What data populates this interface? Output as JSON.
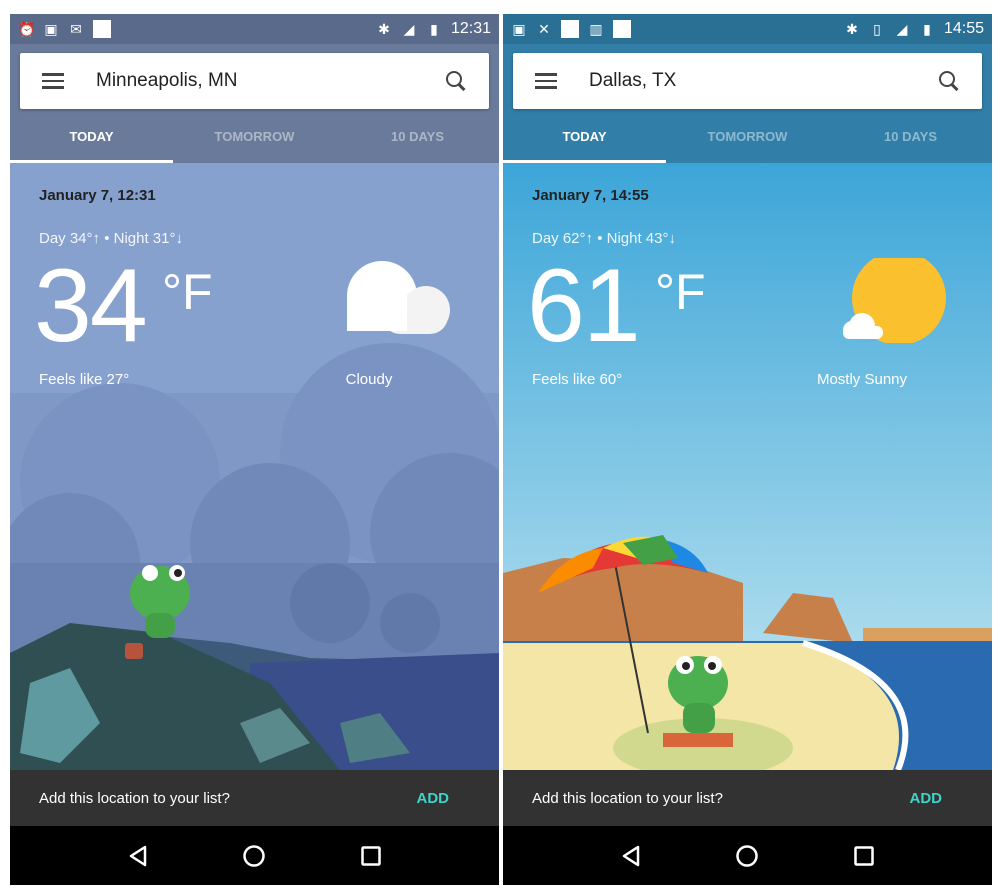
{
  "phones": [
    {
      "status": {
        "left_icons": [
          "alarm-icon",
          "image-icon",
          "inbox-icon",
          "notification-square-icon"
        ],
        "right_icons": [
          "bluetooth-icon",
          "lte-signal-icon",
          "battery-icon"
        ],
        "time": "12:31"
      },
      "location": "Minneapolis, MN",
      "tabs": [
        "TODAY",
        "TOMORROW",
        "10 DAYS"
      ],
      "date": "January 7, 12:31",
      "day_night": "Day 34°↑ • Night 31°↓",
      "temp": "34",
      "unit": "°F",
      "feels": "Feels like 27°",
      "condition": "Cloudy",
      "condition_icon": "cloud-icon",
      "snackbar": {
        "message": "Add this location to your list?",
        "action": "ADD"
      },
      "colors": {
        "status": "#5a6a8a",
        "header": "#6a7a9a",
        "sky": "#87a1cf"
      }
    },
    {
      "status": {
        "left_icons": [
          "image-icon",
          "missed-call-icon",
          "notification-square-icon",
          "chart-icon",
          "notification-square-icon"
        ],
        "right_icons": [
          "bluetooth-icon",
          "vibrate-icon",
          "lte-signal-icon",
          "battery-icon"
        ],
        "time": "14:55"
      },
      "location": "Dallas, TX",
      "tabs": [
        "TODAY",
        "TOMORROW",
        "10 DAYS"
      ],
      "date": "January 7, 14:55",
      "day_night": "Day 62°↑ • Night 43°↓",
      "temp": "61",
      "unit": "°F",
      "feels": "Feels like 60°",
      "condition": "Mostly Sunny",
      "condition_icon": "sun-with-cloud-icon",
      "snackbar": {
        "message": "Add this location to your list?",
        "action": "ADD"
      },
      "colors": {
        "status": "#2a6f94",
        "header": "#317fa8",
        "sky": "#3ca5d8"
      }
    }
  ]
}
